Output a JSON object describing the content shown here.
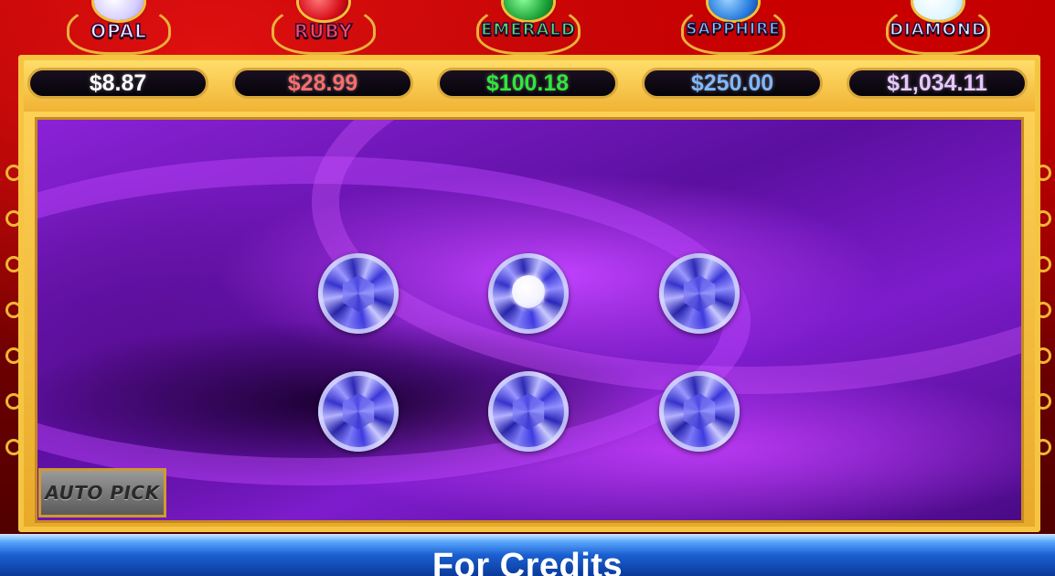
{
  "jackpots": [
    {
      "name": "OPAL",
      "value": "$8.87",
      "color": "#ffffff",
      "gem_color": "#e6e0ff",
      "label_color": "#efe9ff"
    },
    {
      "name": "RUBY",
      "value": "$28.99",
      "color": "#ff6b6b",
      "gem_color": "#d8101c",
      "label_color": "#ff4d5a"
    },
    {
      "name": "EMERALD",
      "value": "$100.18",
      "color": "#2ee83a",
      "gem_color": "#1fa63a",
      "label_color": "#4fe86a"
    },
    {
      "name": "SAPPHIRE",
      "value": "$250.00",
      "color": "#7fb8ff",
      "gem_color": "#2a7fe0",
      "label_color": "#7fd0ff"
    },
    {
      "name": "DIAMOND",
      "value": "$1,034.11",
      "color": "#e7c6ff",
      "gem_color": "#dff6ff",
      "label_color": "#d8f0ff"
    }
  ],
  "gems": [
    {
      "row": 1,
      "col": 1,
      "selected": false
    },
    {
      "row": 1,
      "col": 2,
      "selected": true
    },
    {
      "row": 1,
      "col": 3,
      "selected": false
    },
    {
      "row": 2,
      "col": 1,
      "selected": false
    },
    {
      "row": 2,
      "col": 2,
      "selected": false
    },
    {
      "row": 2,
      "col": 3,
      "selected": false
    }
  ],
  "auto_pick_label": "AUTO PICK",
  "banner_text": "For Credits",
  "colors": {
    "frame_gold": "#f5c542",
    "play_purple": "#7d1ccc",
    "gem_blue": "#3a36d8",
    "banner_blue": "#1a5fd0",
    "background_red": "#b40000"
  }
}
